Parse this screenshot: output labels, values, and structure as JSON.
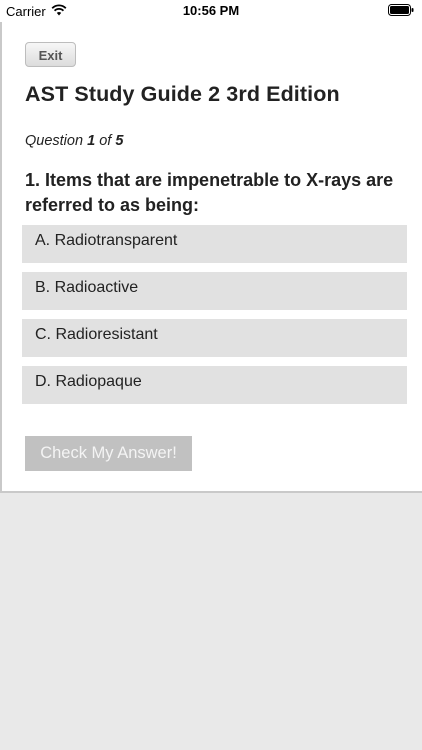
{
  "status_bar": {
    "carrier": "Carrier",
    "time": "10:56 PM",
    "wifi_icon": "wifi-icon",
    "battery_icon": "battery-icon"
  },
  "header": {
    "exit_label": "Exit",
    "title": "AST Study Guide 2 3rd Edition"
  },
  "question": {
    "counter_prefix": "Question",
    "current": "1",
    "counter_of": "of",
    "total": "5",
    "text": "1. Items that are impenetrable to X-rays are referred to as being:"
  },
  "answers": [
    {
      "label": "A. Radiotransparent"
    },
    {
      "label": "B. Radioactive"
    },
    {
      "label": "C. Radioresistant"
    },
    {
      "label": "D. Radiopaque"
    }
  ],
  "actions": {
    "check_label": "Check My Answer!"
  },
  "colors": {
    "page_background": "#e9e9e9",
    "option_background": "#e1e1e1",
    "check_button_background": "#c1c1c1"
  }
}
